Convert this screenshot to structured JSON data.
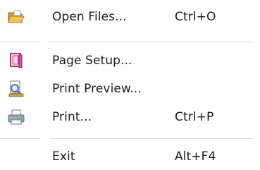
{
  "menu": {
    "items": [
      {
        "label": "Open Files...",
        "shortcut": "Ctrl+O",
        "icon": "open-folder-icon"
      },
      {
        "label": "Page Setup...",
        "shortcut": "",
        "icon": "page-setup-icon"
      },
      {
        "label": "Print Preview...",
        "shortcut": "",
        "icon": "print-preview-icon"
      },
      {
        "label": "Print...",
        "shortcut": "Ctrl+P",
        "icon": "printer-icon"
      },
      {
        "label": "Exit",
        "shortcut": "Alt+F4",
        "icon": ""
      }
    ]
  },
  "colors": {
    "folder": "#e6b24a",
    "folder_dark": "#b7862a",
    "page_setup": "#b1307a",
    "preview_blue": "#4a72b8",
    "printer": "#8b96a6"
  }
}
